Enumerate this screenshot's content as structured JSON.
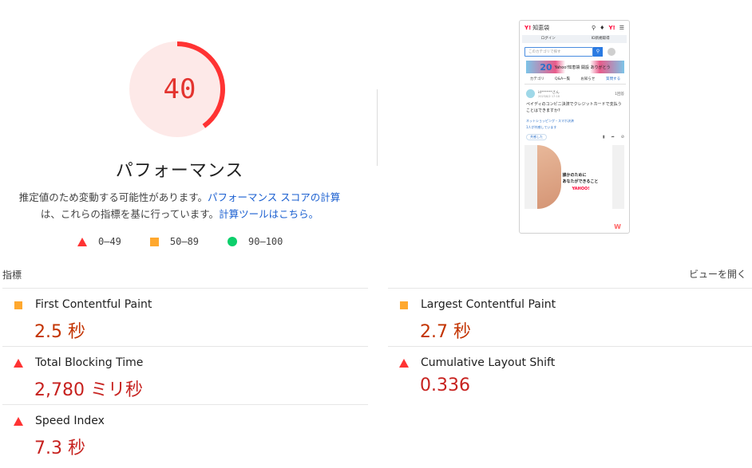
{
  "summary": {
    "score": "40",
    "score_fraction": 0.4,
    "title": "パフォーマンス",
    "desc_prefix": "推定値のため変動する可能性があります。",
    "desc_link1": "パフォーマンス スコアの計算",
    "desc_middle": "は、これらの指標を基に行っています。",
    "desc_link2": "計算ツールはこちら。"
  },
  "colors": {
    "fail": "#ff3333",
    "fail_text": "#c7221f",
    "average": "#ffa82e",
    "average_text": "#c33300",
    "pass": "#0ccf6b",
    "gauge_bg": "#fde9e8",
    "link": "#1a5fd0"
  },
  "legend": [
    {
      "icon": "triangle",
      "range": "0–49"
    },
    {
      "icon": "square",
      "range": "50–89"
    },
    {
      "icon": "circle",
      "range": "90–100"
    }
  ],
  "screenshot": {
    "logo": "Y!",
    "site": "知恵袋",
    "nav": [
      "ログイン",
      "ID新規取得"
    ],
    "search_placeholder": "このカテゴリで探す",
    "banner_num": "20",
    "banner_text": "Yahoo!知恵袋 開設 ありがとう",
    "tabs": [
      "カテゴリ",
      "Q&A一覧",
      "お知らせ",
      "質問する"
    ],
    "user": "id******さん",
    "date": "2023/8/2 17:18",
    "answers": "1回答",
    "question": "ペイディのコンビニ決済でクレジットカードで支払うことはできますか?",
    "category": "ネットショッピング・スマホ決済",
    "answer_note": "1人が共感しています",
    "like": "共感した",
    "ad_text_1": "誰かのために",
    "ad_text_2": "あなたができること",
    "ad_logo": "YAHOO!"
  },
  "metrics_label": "指標",
  "view_toggle": "ビューを開く",
  "metrics": [
    {
      "name": "First Contentful Paint",
      "value": "2.5 秒",
      "rating": "average"
    },
    {
      "name": "Largest Contentful Paint",
      "value": "2.7 秒",
      "rating": "average"
    },
    {
      "name": "Total Blocking Time",
      "value": "2,780 ミリ秒",
      "rating": "fail"
    },
    {
      "name": "Cumulative Layout Shift",
      "value": "0.336",
      "rating": "fail"
    },
    {
      "name": "Speed Index",
      "value": "7.3 秒",
      "rating": "fail"
    }
  ]
}
